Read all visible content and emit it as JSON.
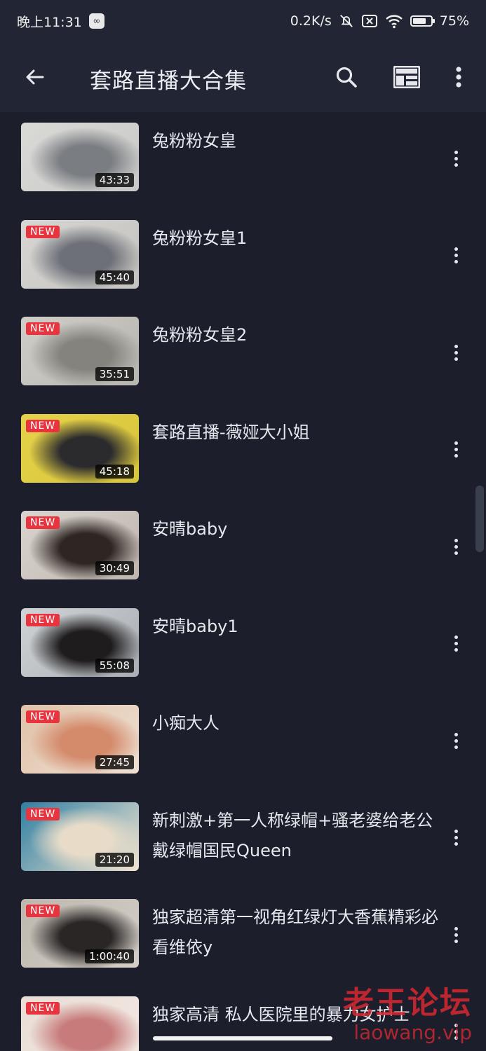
{
  "status": {
    "time": "晚上11:31",
    "network_speed": "0.2K/s",
    "battery": "75%",
    "battery_level": 0.75
  },
  "appbar": {
    "title": "套路直播大合集",
    "icons": [
      "back-arrow-icon",
      "search-icon",
      "layout-icon",
      "more-vert-icon"
    ]
  },
  "videos": [
    {
      "title": "兔粉粉女皇",
      "duration": "43:33",
      "badge": "",
      "thumb_colors": [
        "#d9d9d6",
        "#7a7d82",
        "#c9c9c7"
      ]
    },
    {
      "title": "兔粉粉女皇1",
      "duration": "45:40",
      "badge": "NEW",
      "thumb_colors": [
        "#d7d6d3",
        "#6d7078",
        "#c4c3bf"
      ]
    },
    {
      "title": "兔粉粉女皇2",
      "duration": "35:51",
      "badge": "NEW",
      "thumb_colors": [
        "#cfcdc8",
        "#85837e",
        "#b9b6b0"
      ]
    },
    {
      "title": "套路直播-薇娅大小姐",
      "duration": "45:18",
      "badge": "NEW",
      "thumb_colors": [
        "#e5d24a",
        "#2b2b2e",
        "#d8c53a"
      ]
    },
    {
      "title": "安晴baby",
      "duration": "30:49",
      "badge": "NEW",
      "thumb_colors": [
        "#d9d4cf",
        "#2e2622",
        "#bfb6ae"
      ]
    },
    {
      "title": "安晴baby1",
      "duration": "55:08",
      "badge": "NEW",
      "thumb_colors": [
        "#cfd3d6",
        "#1f1c1d",
        "#a9aeb3"
      ]
    },
    {
      "title": "小痴大人",
      "duration": "27:45",
      "badge": "NEW",
      "thumb_colors": [
        "#e0c2a8",
        "#d48b6c",
        "#efe0d4"
      ]
    },
    {
      "title": "新刺激+第一人称绿帽+骚老婆给老公戴绿帽国民Queen",
      "duration": "21:20",
      "badge": "NEW",
      "thumb_colors": [
        "#2f7fa3",
        "#e8dcc8",
        "#f2e4d0"
      ]
    },
    {
      "title": "独家超清第一视角红绿灯大香蕉精彩必看维依y",
      "duration": "1:00:40",
      "badge": "NEW",
      "thumb_colors": [
        "#bdb7ae",
        "#2a2626",
        "#d4cfc7"
      ]
    },
    {
      "title": "独家高清 私人医院里的暴力女护士",
      "duration": "",
      "badge": "NEW",
      "thumb_colors": [
        "#e9ddd6",
        "#c77b7a",
        "#f2e8e2"
      ]
    }
  ],
  "watermark": {
    "brand": "老王论坛",
    "site": "laowang.vip"
  }
}
